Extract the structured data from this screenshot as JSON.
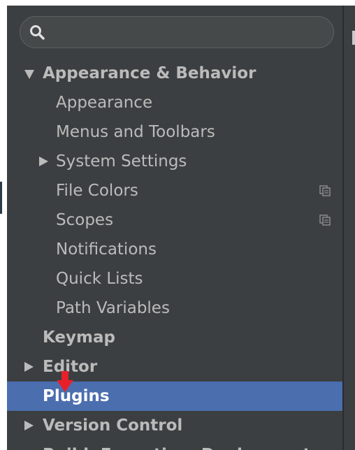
{
  "search": {
    "value": "",
    "placeholder": ""
  },
  "tree": {
    "appearance_behavior": "Appearance & Behavior",
    "appearance": "Appearance",
    "menus_toolbars": "Menus and Toolbars",
    "system_settings": "System Settings",
    "file_colors": "File Colors",
    "scopes": "Scopes",
    "notifications": "Notifications",
    "quick_lists": "Quick Lists",
    "path_variables": "Path Variables",
    "keymap": "Keymap",
    "editor": "Editor",
    "plugins": "Plugins",
    "version_control": "Version Control",
    "build_execution": "Build, Execution, Deployment"
  },
  "state": {
    "selected_item": "Plugins",
    "expanded": [
      "Appearance & Behavior"
    ]
  },
  "icons": {
    "search": "search-icon",
    "expand": "triangle-down-icon",
    "collapse": "triangle-right-icon",
    "project_level": "copy-icon",
    "annotation": "red-arrow-down-icon"
  },
  "colors": {
    "sidebar_bg": "#3c3f41",
    "selection_bg": "#4b6eaf",
    "text": "#bbbbbb",
    "selected_text": "#ffffff",
    "annotation": "#e8202a"
  }
}
